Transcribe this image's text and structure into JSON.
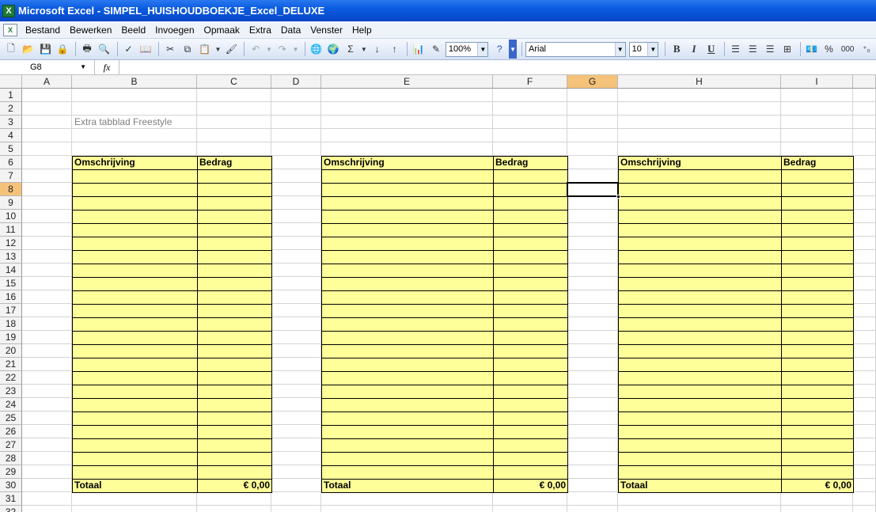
{
  "window": {
    "title": "Microsoft Excel - SIMPEL_HUISHOUDBOEKJE_Excel_DELUXE"
  },
  "menu": {
    "items": [
      "Bestand",
      "Bewerken",
      "Beeld",
      "Invoegen",
      "Opmaak",
      "Extra",
      "Data",
      "Venster",
      "Help"
    ]
  },
  "toolbar": {
    "zoom": "100%",
    "font_name": "Arial",
    "font_size": "10",
    "bold_label": "B",
    "italic_label": "I",
    "underline_label": "U",
    "sum_label": "Σ",
    "percent_label": "%",
    "thousands_label": "000"
  },
  "formula_bar": {
    "name_box": "G8",
    "fx_label": "fx",
    "formula": ""
  },
  "grid": {
    "columns": [
      "A",
      "B",
      "C",
      "D",
      "E",
      "F",
      "G",
      "H",
      "I"
    ],
    "rows": [
      "1",
      "2",
      "3",
      "4",
      "5",
      "6",
      "7",
      "8",
      "9",
      "10",
      "11",
      "12",
      "13",
      "14",
      "15",
      "16",
      "17",
      "18",
      "19",
      "20",
      "21",
      "22",
      "23",
      "24",
      "25",
      "26",
      "27",
      "28",
      "29",
      "30",
      "31",
      "32"
    ],
    "active_column": "G",
    "active_row": "8",
    "selected_cell": "G8"
  },
  "sheet": {
    "freestyle_label": "Extra tabblad Freestyle",
    "blocks": [
      {
        "header_desc": "Omschrijving",
        "header_amount": "Bedrag",
        "total_label": "Totaal",
        "total_value": "€ 0,00"
      },
      {
        "header_desc": "Omschrijving",
        "header_amount": "Bedrag",
        "total_label": "Totaal",
        "total_value": "€ 0,00"
      },
      {
        "header_desc": "Omschrijving",
        "header_amount": "Bedrag",
        "total_label": "Totaal",
        "total_value": "€ 0,00"
      }
    ]
  },
  "colors": {
    "block_fill": "#ffff99",
    "title_bar": "#0a5be0",
    "active_header": "#f5c27a"
  }
}
